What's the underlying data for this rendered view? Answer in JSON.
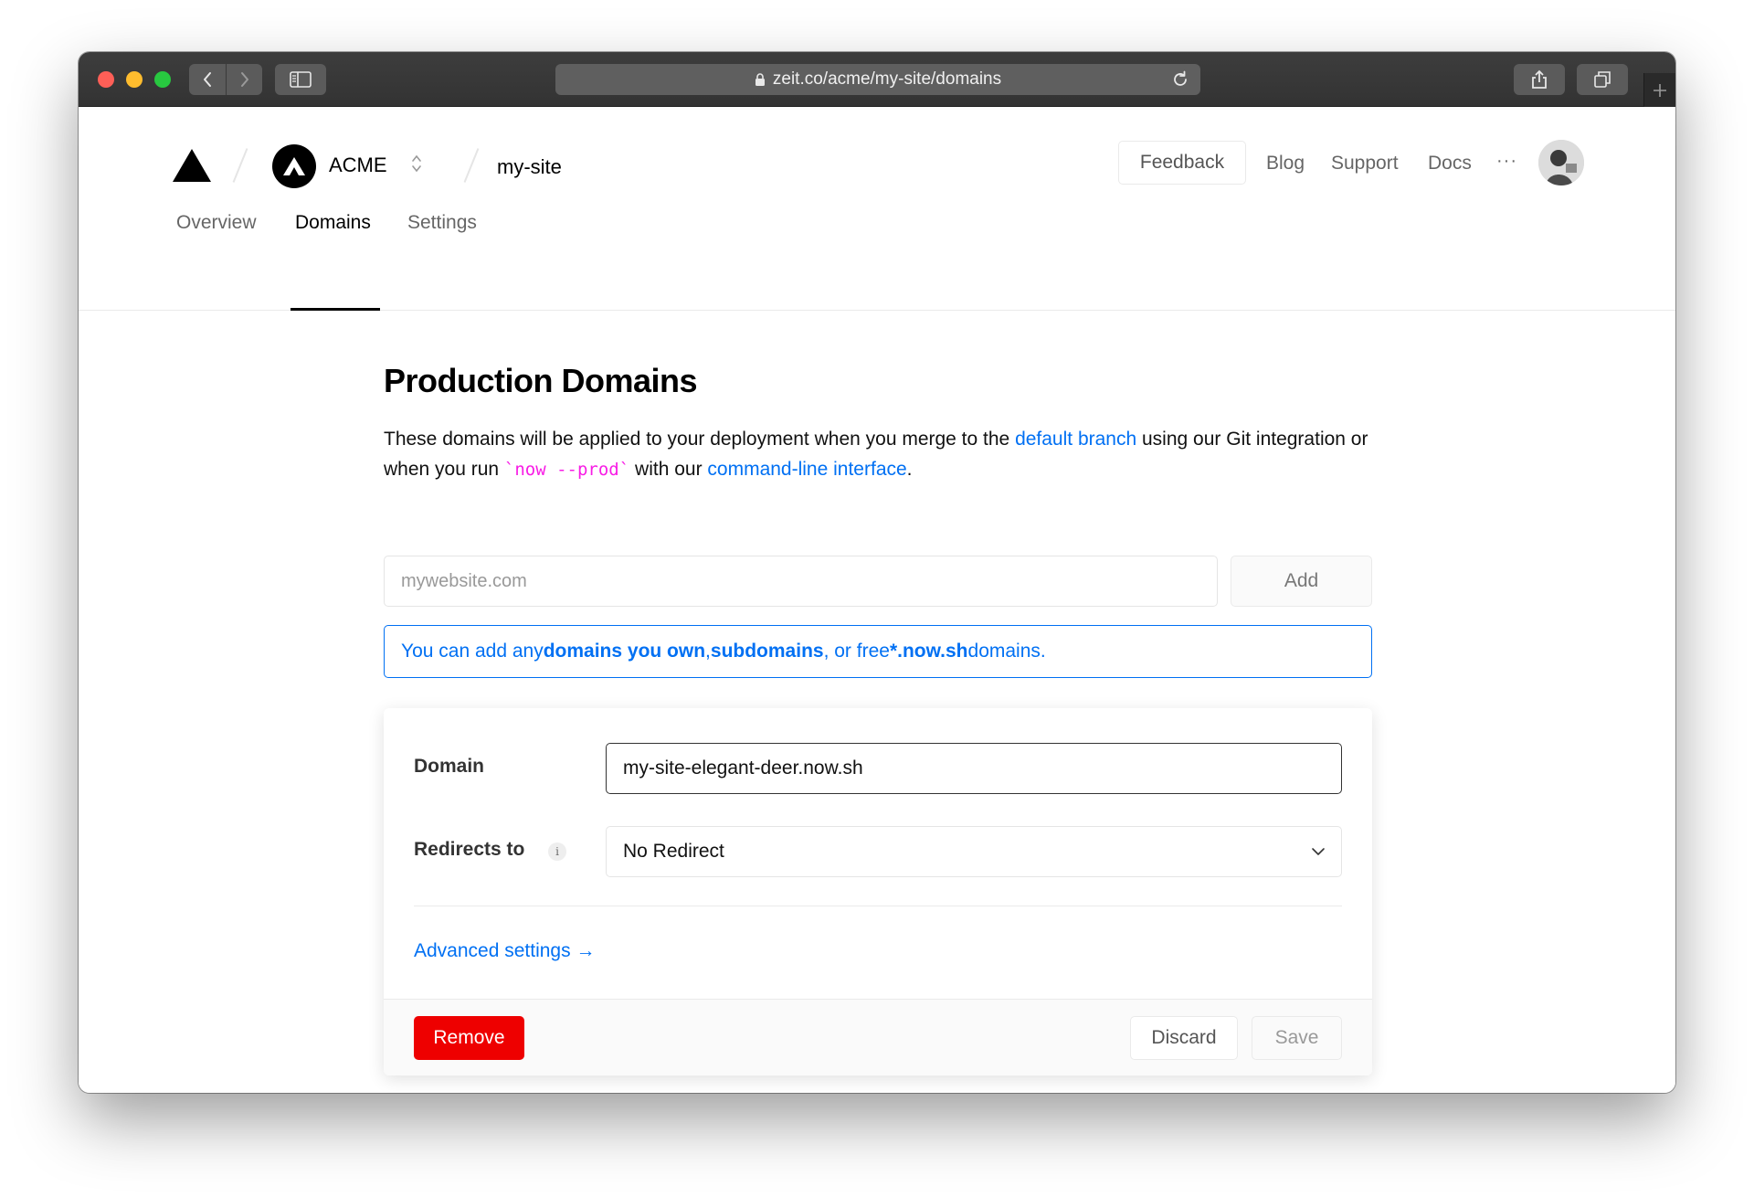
{
  "browser": {
    "url": "zeit.co/acme/my-site/domains"
  },
  "header": {
    "team_name": "ACME",
    "project_name": "my-site",
    "feedback_label": "Feedback",
    "links": [
      "Blog",
      "Support",
      "Docs"
    ],
    "more_label": "···"
  },
  "subnav": {
    "tabs": [
      "Overview",
      "Domains",
      "Settings"
    ],
    "active": "Domains"
  },
  "main": {
    "title": "Production Domains",
    "description": {
      "part1": "These domains will be applied to your deployment when you merge to the ",
      "link1": "default branch",
      "part2": " using our Git integration or when you run ",
      "code": "`now --prod`",
      "part3": " with our ",
      "link2": "command-line interface",
      "part4": "."
    },
    "add_input_placeholder": "mywebsite.com",
    "add_button": "Add",
    "note": {
      "part1": "You can add any ",
      "bold1": "domains you own",
      "part2": ", ",
      "bold2": "subdomains",
      "part3": ", or free ",
      "bold3": "*.now.sh",
      "part4": " domains."
    }
  },
  "domain_card": {
    "domain_label": "Domain",
    "domain_value": "my-site-elegant-deer.now.sh",
    "redirect_label": "Redirects to",
    "info_glyph": "i",
    "redirect_value": "No Redirect",
    "advanced_link": "Advanced settings →",
    "remove_button": "Remove",
    "discard_button": "Discard",
    "save_button": "Save"
  },
  "colors": {
    "accent": "#0070f3",
    "danger": "#ee0000",
    "code": "#f81ce5"
  }
}
